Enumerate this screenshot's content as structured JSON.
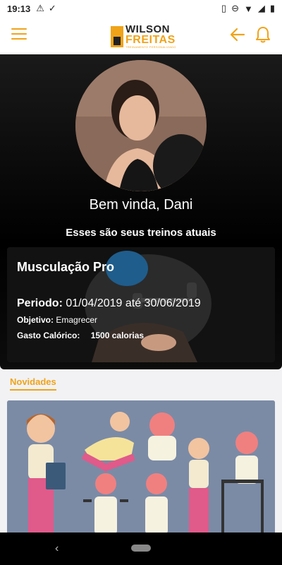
{
  "status_bar": {
    "time": "19:13"
  },
  "app_bar": {
    "logo_line1": "WILSON",
    "logo_line2": "FREITAS",
    "logo_tag": "TREINAMENTO PERSONALIZADO"
  },
  "hero": {
    "greeting": "Bem vinda, Dani",
    "subtitle": "Esses são seus treinos atuais"
  },
  "workout": {
    "title": "Musculação Pro",
    "period_label": "Periodo:",
    "period_value": "01/04/2019 até 30/06/2019",
    "objective_label": "Objetivo:",
    "objective_value": "Emagrecer",
    "calories_label": "Gasto Calórico:",
    "calories_value": "1500 calorias"
  },
  "news": {
    "label": "Novidades"
  },
  "colors": {
    "accent": "#f0a319",
    "hero_bg": "#000000",
    "news_bg": "#7b8ba6"
  }
}
